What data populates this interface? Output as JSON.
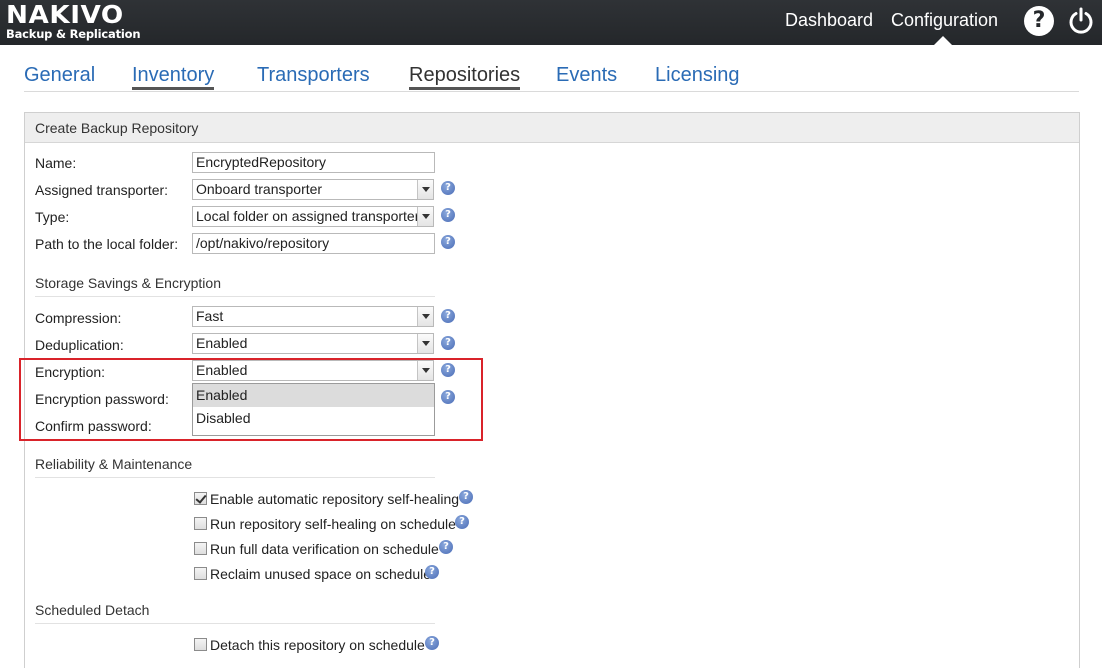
{
  "header": {
    "logo_name": "NAKIVO",
    "logo_tagline": "Backup & Replication",
    "nav": {
      "dashboard": "Dashboard",
      "configuration": "Configuration"
    },
    "help_glyph": "?"
  },
  "tabs": [
    {
      "label": "General"
    },
    {
      "label": "Inventory"
    },
    {
      "label": "Transporters"
    },
    {
      "label": "Repositories"
    },
    {
      "label": "Events"
    },
    {
      "label": "Licensing"
    }
  ],
  "panel": {
    "title": "Create Backup Repository",
    "fields": {
      "name": {
        "label": "Name:",
        "value": "EncryptedRepository"
      },
      "transporter": {
        "label": "Assigned transporter:",
        "value": "Onboard transporter"
      },
      "type": {
        "label": "Type:",
        "value": "Local folder on assigned transporter"
      },
      "path": {
        "label": "Path to the local folder:",
        "value": "/opt/nakivo/repository"
      }
    },
    "storage_section": {
      "title": "Storage Savings & Encryption",
      "compression": {
        "label": "Compression:",
        "value": "Fast"
      },
      "deduplication": {
        "label": "Deduplication:",
        "value": "Enabled"
      },
      "encryption": {
        "label": "Encryption:",
        "value": "Enabled",
        "options": [
          "Enabled",
          "Disabled"
        ]
      },
      "encryption_password": {
        "label": "Encryption password:"
      },
      "confirm_password": {
        "label": "Confirm password:"
      }
    },
    "reliability_section": {
      "title": "Reliability & Maintenance",
      "options": [
        {
          "label": "Enable automatic repository self-healing",
          "checked": true
        },
        {
          "label": "Run repository self-healing on schedule",
          "checked": false
        },
        {
          "label": "Run full data verification on schedule",
          "checked": false
        },
        {
          "label": "Reclaim unused space on schedule",
          "checked": false
        }
      ]
    },
    "detach_section": {
      "title": "Scheduled Detach",
      "options": [
        {
          "label": "Detach this repository on schedule",
          "checked": false
        }
      ]
    }
  },
  "colors": {
    "accent": "#2a6bb5",
    "topbar": "#2b2e31",
    "highlight": "#d9232a",
    "help_icon": "#4a6cb6"
  },
  "icons": [
    "help-icon",
    "power-icon",
    "question-mark-icon",
    "dropdown-arrow-icon",
    "checkbox-icon"
  ]
}
